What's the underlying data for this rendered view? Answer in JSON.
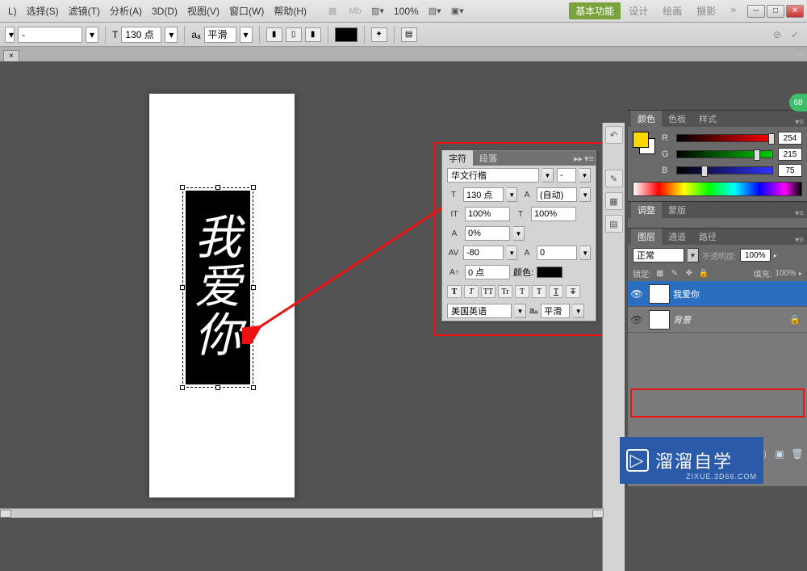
{
  "menu": {
    "items": [
      "L)",
      "选择(S)",
      "滤镜(T)",
      "分析(A)",
      "3D(D)",
      "视图(V)",
      "窗口(W)",
      "帮助(H)"
    ],
    "zoom": "100%",
    "top_tabs": [
      "基本功能",
      "设计",
      "绘画",
      "摄影"
    ]
  },
  "options": {
    "font_size": "130 点",
    "aa_label": "aₐ",
    "aa_value": "平滑"
  },
  "doc_tab": {
    "close": "×"
  },
  "canvas_text": [
    "我",
    "爱",
    "你"
  ],
  "char_panel": {
    "tabs": [
      "字符",
      "段落"
    ],
    "font_family": "华文行楷",
    "font_style": "-",
    "size": "130 点",
    "leading_label": "(自动)",
    "vscale": "100%",
    "hscale": "100%",
    "tracking1": "0%",
    "tracking2": "-80",
    "tracking3": "0",
    "baseline": "0 点",
    "color_label": "颜色:",
    "lang": "美国英语",
    "aa": "平滑",
    "style_buttons": [
      "T",
      "T",
      "TT",
      "Tr",
      "T",
      "T",
      "T",
      "T"
    ]
  },
  "color_panel": {
    "tabs": [
      "颜色",
      "色板",
      "样式"
    ],
    "r": 254,
    "g": 215,
    "b": 75
  },
  "adjust_panel": {
    "tabs": [
      "调整",
      "蒙版"
    ]
  },
  "layers_panel": {
    "tabs": [
      "图层",
      "通道",
      "路径"
    ],
    "blend_mode": "正常",
    "opacity_label": "不透明度:",
    "opacity": "100%",
    "lock_label": "锁定:",
    "fill_label": "填充:",
    "fill": "100%",
    "layers": [
      {
        "name": "我爱你",
        "thumb": "T",
        "selected": true
      },
      {
        "name": "背景",
        "thumb": "",
        "selected": false,
        "locked": true
      }
    ]
  },
  "watermark": {
    "main": "溜溜自学",
    "sub": "ZIXUE.3D66.COM"
  },
  "badge": "68"
}
